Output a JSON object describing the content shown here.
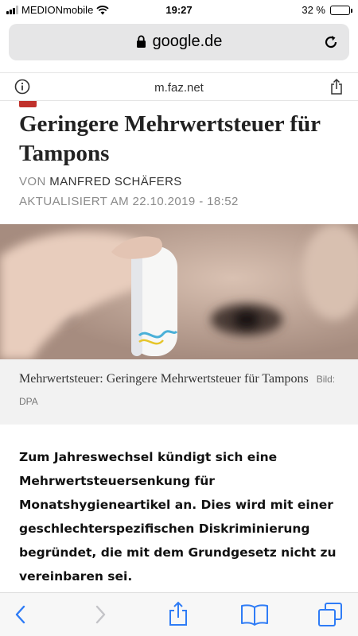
{
  "status_bar": {
    "carrier": "MEDIONmobile",
    "time": "19:27",
    "battery_text": "32 %",
    "battery_level": 0.32,
    "icons": [
      "signal-icon",
      "wifi-icon",
      "battery-icon"
    ]
  },
  "address_bar": {
    "url": "google.de",
    "icons": [
      "lock-icon",
      "reload-icon"
    ]
  },
  "site_bar": {
    "domain": "m.faz.net",
    "icons": [
      "info-icon",
      "share-icon"
    ]
  },
  "article": {
    "headline": "Geringere Mehrwertsteuer für Tampons",
    "byline_prefix": "VON",
    "author": "MANFRED SCHÄFERS",
    "updated": "AKTUALISIERT AM 22.10.2019 - 18:52",
    "image_caption": "Mehrwertsteuer: Geringere Mehrwertsteuer für Tampons",
    "image_credit": "Bild: DPA",
    "lead": "Zum Jahreswechsel kündigt sich eine Mehrwertsteuersenkung für Monatshygieneartikel an. Dies wird mit einer geschlechterspezifischen Diskriminierung begründet, die mit dem Grundgesetz nicht zu vereinbaren sei."
  },
  "toolbar": {
    "icons": [
      "back-icon",
      "forward-icon",
      "share-icon",
      "bookmarks-icon",
      "tabs-icon"
    ]
  },
  "colors": {
    "ios_blue": "#2f7cf6",
    "accent_red": "#c0312b"
  }
}
